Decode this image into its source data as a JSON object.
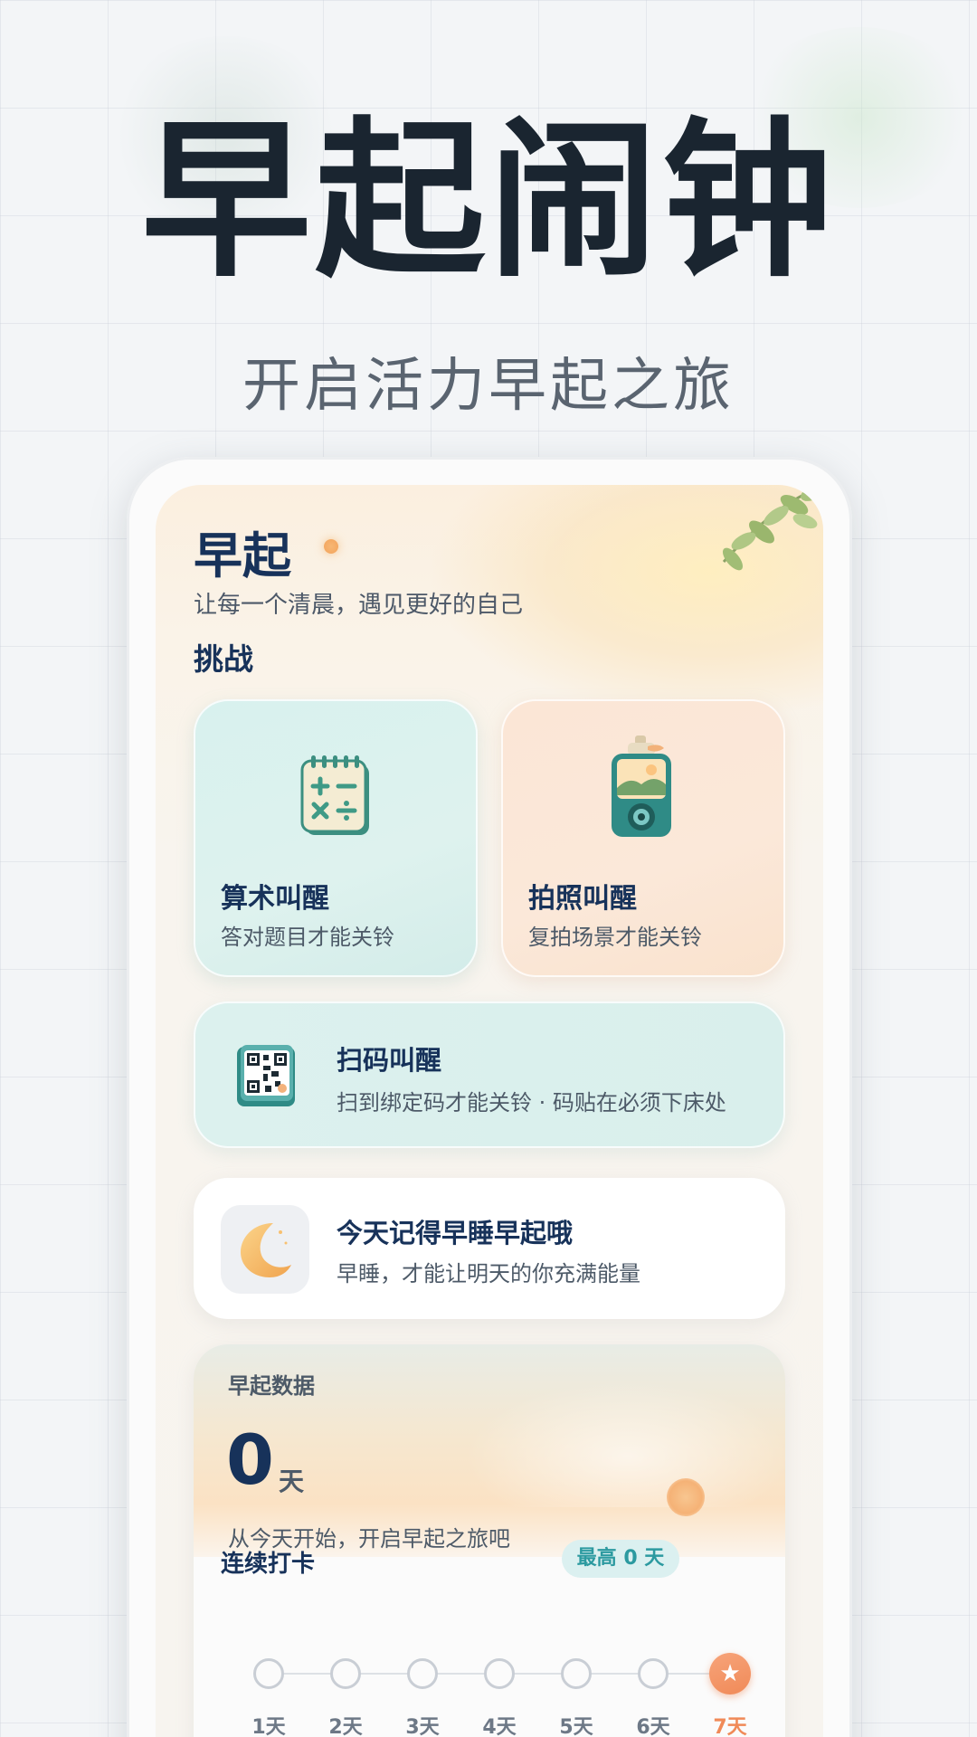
{
  "hero": {
    "title": "早起闹钟",
    "subtitle": "开启活力早起之旅"
  },
  "app": {
    "title": "早起",
    "subtitle": "让每一个清晨，遇见更好的自己",
    "section_title": "挑战"
  },
  "challenges": [
    {
      "label": "算术叫醒",
      "desc": "答对题目才能关铃",
      "icon": "calculator-notepad-icon"
    },
    {
      "label": "拍照叫醒",
      "desc": "复拍场景才能关铃",
      "icon": "camera-icon"
    },
    {
      "label": "扫码叫醒",
      "desc": "扫到绑定码才能关铃 · 码贴在必须下床处",
      "icon": "qr-code-icon"
    }
  ],
  "reminder": {
    "title": "今天记得早睡早起哦",
    "desc": "早睡，才能让明天的你充满能量",
    "icon": "crescent-moon-icon"
  },
  "stats": {
    "title": "早起数据",
    "count": "0",
    "unit": "天",
    "desc": "从今天开始，开启早起之旅吧",
    "streak_title": "连续打卡",
    "best_label": "最高 0 天",
    "days": [
      "1天",
      "2天",
      "3天",
      "4天",
      "5天",
      "6天",
      "7天"
    ],
    "active_day_index": 6
  },
  "colors": {
    "primary_text": "#17325a",
    "accent_orange": "#f08a58",
    "accent_teal": "#2c9aa0"
  }
}
